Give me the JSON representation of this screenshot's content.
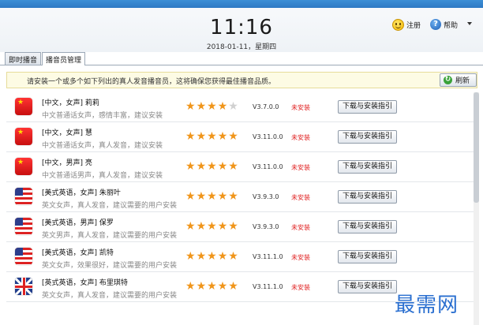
{
  "header": {
    "time": "11:16",
    "date": "2018-01-11，星期四",
    "register_label": "注册",
    "help_label": "帮助"
  },
  "tabs": [
    {
      "label": "即时播音"
    },
    {
      "label": "播音员管理"
    }
  ],
  "info": {
    "text": "请安装一个或多个如下列出的真人发音播音员，这将确保您获得最佳播音品质。",
    "refresh_label": "刷新"
  },
  "voices": [
    {
      "flag": "cn",
      "name": "[中文，女声] 莉莉",
      "desc": "中文普通话女声，感情丰富，建议安装",
      "rating": 4,
      "version": "V3.7.0.0",
      "status": "未安装",
      "button": "下载与安装指引"
    },
    {
      "flag": "cn",
      "name": "[中文，女声] 慧",
      "desc": "中文普通话女声，真人发音，建议安装",
      "rating": 5,
      "version": "V3.11.0.0",
      "status": "未安装",
      "button": "下载与安装指引"
    },
    {
      "flag": "cn",
      "name": "[中文，男声] 亮",
      "desc": "中文普通话男声，真人发音，建议安装",
      "rating": 5,
      "version": "V3.11.0.0",
      "status": "未安装",
      "button": "下载与安装指引"
    },
    {
      "flag": "us",
      "name": "[美式英语，女声] 朱丽叶",
      "desc": "英文女声，真人发音，建议需要的用户安装",
      "rating": 5,
      "version": "V3.9.3.0",
      "status": "未安装",
      "button": "下载与安装指引"
    },
    {
      "flag": "us",
      "name": "[美式英语，男声] 保罗",
      "desc": "英文男声，真人发音，建议需要的用户安装",
      "rating": 5,
      "version": "V3.9.3.0",
      "status": "未安装",
      "button": "下载与安装指引"
    },
    {
      "flag": "us",
      "name": "[美式英语，女声] 凯特",
      "desc": "英文女声，效果很好，建议需要的用户安装",
      "rating": 5,
      "version": "V3.11.1.0",
      "status": "未安装",
      "button": "下载与安装指引"
    },
    {
      "flag": "uk",
      "name": "[英式英语，女声] 布里琪特",
      "desc": "英文女声，真人发音，建议需要的用户安装",
      "rating": 5,
      "version": "V3.11.1.0",
      "status": "未安装",
      "button": "下载与安装指引"
    }
  ],
  "watermark": "最需网",
  "icons": {
    "register": "smiley-icon",
    "help": "help-icon",
    "refresh": "refresh-icon",
    "dropdown": "chevron-down-icon"
  },
  "colors": {
    "status": "#e02020",
    "star": "#f0951a",
    "title_bar": "#2e79c4",
    "watermark": "#2a6fd0"
  }
}
